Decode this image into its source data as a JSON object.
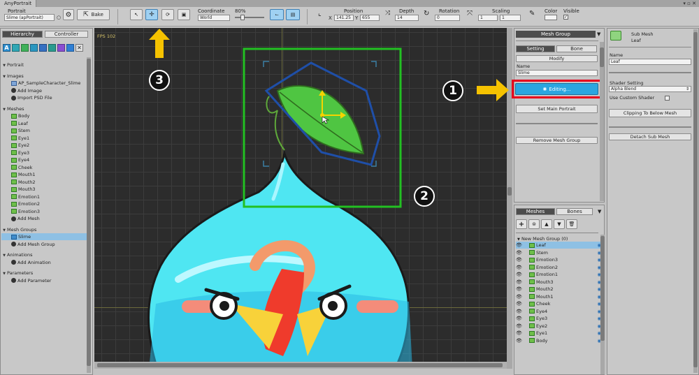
{
  "app": {
    "window_tab": "AnyPortrait"
  },
  "toolbar": {
    "portrait_label": "Portrait",
    "portrait_value": "Slime (apPortrait)",
    "bake_label": "Bake",
    "coordinate_label": "Coordinate",
    "coordinate_value": "World",
    "zoom_value": "80%",
    "position_label": "Position",
    "pos_x_label": "X",
    "pos_x": "141.25",
    "pos_y_label": "Y",
    "pos_y": "655",
    "depth_label": "Depth",
    "depth_value": "14",
    "rotation_label": "Rotation",
    "rotation_value": "0",
    "scaling_label": "Scaling",
    "scale_x": "1",
    "scale_y": "1",
    "color_label": "Color",
    "visible_label": "Visible"
  },
  "left_panel": {
    "tab_hierarchy": "Hierarchy",
    "tab_controller": "Controller",
    "filter_icons": [
      "A",
      "portrait",
      "image",
      "mesh",
      "meshgroup",
      "anim",
      "param",
      "x"
    ],
    "items": [
      {
        "text": "Portrait",
        "kind": "section"
      },
      {
        "text": "Images",
        "kind": "section"
      },
      {
        "text": "AP_SampleCharacter_Slime",
        "kind": "image"
      },
      {
        "text": "Add Image",
        "kind": "add"
      },
      {
        "text": "Import PSD File",
        "kind": "add"
      },
      {
        "text": "Meshes",
        "kind": "section"
      },
      {
        "text": "Body",
        "kind": "mesh"
      },
      {
        "text": "Leaf",
        "kind": "mesh"
      },
      {
        "text": "Stem",
        "kind": "mesh"
      },
      {
        "text": "Eye1",
        "kind": "mesh"
      },
      {
        "text": "Eye2",
        "kind": "mesh"
      },
      {
        "text": "Eye3",
        "kind": "mesh"
      },
      {
        "text": "Eye4",
        "kind": "mesh"
      },
      {
        "text": "Cheek",
        "kind": "mesh"
      },
      {
        "text": "Mouth1",
        "kind": "mesh"
      },
      {
        "text": "Mouth2",
        "kind": "mesh"
      },
      {
        "text": "Mouth3",
        "kind": "mesh"
      },
      {
        "text": "Emotion1",
        "kind": "mesh"
      },
      {
        "text": "Emotion2",
        "kind": "mesh"
      },
      {
        "text": "Emotion3",
        "kind": "mesh"
      },
      {
        "text": "Add Mesh",
        "kind": "add"
      },
      {
        "text": "Mesh Groups",
        "kind": "section"
      },
      {
        "text": "Slime",
        "kind": "group",
        "selected": true
      },
      {
        "text": "Add Mesh Group",
        "kind": "add"
      },
      {
        "text": "Animations",
        "kind": "section"
      },
      {
        "text": "Add Animation",
        "kind": "add"
      },
      {
        "text": "Parameters",
        "kind": "section"
      },
      {
        "text": "Add Parameter",
        "kind": "add"
      }
    ]
  },
  "canvas": {
    "fps": "FPS 102"
  },
  "mesh_group_panel": {
    "header": "Mesh Group",
    "tab_setting": "Setting",
    "tab_bone": "Bone",
    "modify_label": "Modify",
    "name_label": "Name",
    "name_value": "Slime",
    "editing_label": "Editing...",
    "set_main_label": "Set Main Portrait",
    "remove_label": "Remove Mesh Group"
  },
  "meshes_panel": {
    "tab_meshes": "Meshes",
    "tab_bones": "Bones",
    "group_title": "New Mesh Group (0)",
    "rows": [
      "Leaf",
      "Stem",
      "Emotion3",
      "Emotion2",
      "Emotion1",
      "Mouth3",
      "Mouth2",
      "Mouth1",
      "Cheek",
      "Eye4",
      "Eye3",
      "Eye2",
      "Eye1",
      "Body"
    ]
  },
  "sub_mesh_panel": {
    "title": "Sub Mesh",
    "subtitle": "Leaf",
    "name_label": "Name",
    "name_value": "Leaf",
    "shader_label": "Shader Setting",
    "shader_value": "Alpha Blend",
    "custom_shader_label": "Use Custom Shader",
    "clip_label": "Clipping To Below Mesh",
    "detach_label": "Detach Sub Mesh"
  },
  "annotations": {
    "badge1": "1",
    "badge2": "2",
    "badge3": "3"
  },
  "colors": {
    "accent_blue": "#2ba6e0",
    "highlight_red": "#e8001c",
    "arrow_yellow": "#f5c200",
    "frame_green": "#22c022",
    "mesh_outline": "#1f4fa8"
  }
}
